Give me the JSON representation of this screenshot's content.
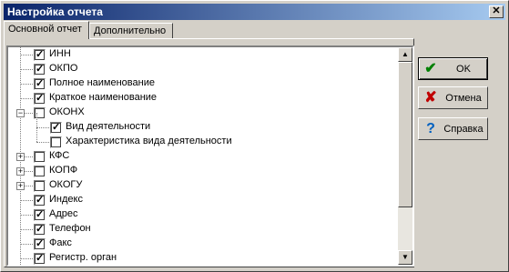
{
  "window": {
    "title": "Настройка отчета",
    "close_glyph": "✕"
  },
  "tabs": [
    {
      "label": "Основной отчет",
      "active": true
    },
    {
      "label": "Дополнительно",
      "active": false
    }
  ],
  "tree": {
    "items": [
      {
        "label": "ИНН",
        "checked": true,
        "level": 0,
        "expander": null
      },
      {
        "label": "ОКПО",
        "checked": true,
        "level": 0,
        "expander": null
      },
      {
        "label": "Полное наименование",
        "checked": true,
        "level": 0,
        "expander": null
      },
      {
        "label": "Краткое наименование",
        "checked": true,
        "level": 0,
        "expander": null
      },
      {
        "label": "ОКОНХ",
        "checked": false,
        "level": 0,
        "expander": "minus"
      },
      {
        "label": "Вид деятельности",
        "checked": true,
        "level": 1,
        "expander": null
      },
      {
        "label": "Характеристика вида деятельности",
        "checked": false,
        "level": 1,
        "expander": null
      },
      {
        "label": "КФС",
        "checked": false,
        "level": 0,
        "expander": "plus"
      },
      {
        "label": "КОПФ",
        "checked": false,
        "level": 0,
        "expander": "plus"
      },
      {
        "label": "ОКОГУ",
        "checked": false,
        "level": 0,
        "expander": "plus"
      },
      {
        "label": "Индекс",
        "checked": true,
        "level": 0,
        "expander": null
      },
      {
        "label": "Адрес",
        "checked": true,
        "level": 0,
        "expander": null
      },
      {
        "label": "Телефон",
        "checked": true,
        "level": 0,
        "expander": null
      },
      {
        "label": "Факс",
        "checked": true,
        "level": 0,
        "expander": null
      },
      {
        "label": "Регистр. орган",
        "checked": true,
        "level": 0,
        "expander": null
      }
    ],
    "check_glyph": "✓",
    "scroll_up_glyph": "▲",
    "scroll_down_glyph": "▼"
  },
  "buttons": {
    "ok": {
      "label": "OK",
      "icon": "checkmark-icon",
      "glyph": "✔",
      "color": "#008000"
    },
    "cancel": {
      "label": "Отмена",
      "icon": "cross-icon",
      "glyph": "✘",
      "color": "#c00000"
    },
    "help": {
      "label": "Справка",
      "icon": "question-icon",
      "glyph": "?",
      "color": "#0060c0"
    }
  },
  "colors": {
    "titlebar_start": "#0a246a",
    "titlebar_end": "#a6caf0",
    "face": "#d4d0c8"
  }
}
